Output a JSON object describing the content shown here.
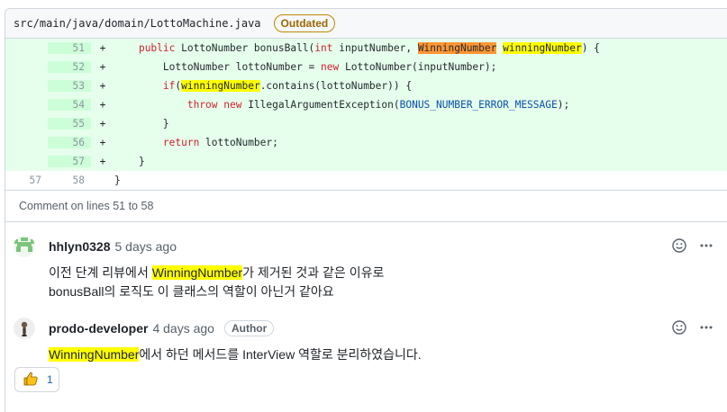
{
  "file": {
    "path": "src/main/java/domain/LottoMachine.java",
    "status_badge": "Outdated"
  },
  "diff_lines": [
    {
      "old": "",
      "new": "51",
      "mark": "+"
    },
    {
      "old": "",
      "new": "52",
      "mark": "+"
    },
    {
      "old": "",
      "new": "53",
      "mark": "+"
    },
    {
      "old": "",
      "new": "54",
      "mark": "+"
    },
    {
      "old": "",
      "new": "55",
      "mark": "+"
    },
    {
      "old": "",
      "new": "56",
      "mark": "+"
    },
    {
      "old": "",
      "new": "57",
      "mark": "+"
    },
    {
      "old": "57",
      "new": "58",
      "mark": ""
    }
  ],
  "code": {
    "l51": {
      "indent": "    ",
      "kw": "public",
      "t1": " LottoNumber bonusBall(",
      "kw2": "int",
      "t2": " inputNumber, ",
      "h1": "WinningNumber",
      "sp": " ",
      "h2": "winningNumber",
      "t3": ") {"
    },
    "l52": {
      "indent": "        ",
      "t1": "LottoNumber lottoNumber = ",
      "kw": "new",
      "t2": " LottoNumber(inputNumber);"
    },
    "l53": {
      "indent": "        ",
      "kw": "if",
      "t1": "(",
      "h1": "winningNumber",
      "t2": ".contains(lottoNumber)) {"
    },
    "l54": {
      "indent": "            ",
      "kw": "throw",
      "sp": " ",
      "kw2": "new",
      "t1": " IllegalArgumentException(",
      "c1": "BONUS_NUMBER_ERROR_MESSAGE",
      "t2": ");"
    },
    "l55": {
      "indent": "        ",
      "t1": "}"
    },
    "l56": {
      "indent": "        ",
      "kw": "return",
      "t1": " lottoNumber;"
    },
    "l57": {
      "indent": "    ",
      "t1": "}"
    },
    "l58": {
      "indent": "",
      "t1": "}"
    }
  },
  "comment_range": "Comment on lines 51 to 58",
  "comments": [
    {
      "author": "hhlyn0328",
      "time": "5 days ago",
      "line1_pre": "이전 단계 리뷰에서 ",
      "line1_hl": "WinningNumber",
      "line1_post": "가 제거된 것과 같은 이유로",
      "line2": "bonusBall의 로직도 이 클래스의 역할이 아닌거 같아요"
    },
    {
      "author": "prodo-developer",
      "time": "4 days ago",
      "badge": "Author",
      "line1_hl": "WinningNumber",
      "line1_post": "에서 하던 메서드를 InterView 역할로 분리하였습니다."
    }
  ],
  "reaction": {
    "icon": "thumbs-up-emoji",
    "count": "1"
  },
  "colors": {
    "added_bg": "#e6ffec",
    "added_gutter": "#ccffd8",
    "highlight": "#ffff00",
    "highlight_current": "#ff9632",
    "outdated": "#9a6700"
  }
}
